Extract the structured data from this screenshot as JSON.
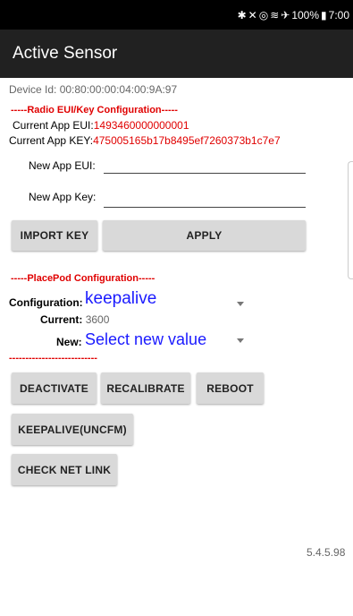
{
  "status_bar": {
    "bluetooth": "✱",
    "mute": "✕",
    "hotspot": "◎",
    "wifi": "≋",
    "airplane": "✈",
    "battery": "100%",
    "battery_icon": "▮",
    "time": "7:00"
  },
  "app_bar": {
    "title": "Active Sensor"
  },
  "device": {
    "id_label": "Device Id: 00:80:00:00:04:00:9A:97"
  },
  "radio": {
    "header": "-----Radio EUI/Key Configuration-----",
    "eui_label": "Current App EUI:",
    "eui_value": "1493460000000001",
    "key_label": "Current App KEY:",
    "key_value": "475005165b17b8495ef7260373b1c7e7",
    "new_eui_label": "New App EUI:",
    "new_eui_value": "",
    "new_key_label": "New App Key:",
    "new_key_value": ""
  },
  "buttons": {
    "import_key": "IMPORT KEY",
    "apply": "APPLY",
    "deactivate": "DEACTIVATE",
    "recalibrate": "RECALIBRATE",
    "reboot": "REBOOT",
    "keepalive": "KEEPALIVE(UNCFM)",
    "check_net_link": "CHECK NET LINK"
  },
  "placepod": {
    "header": "-----PlacePod Configuration-----",
    "config_label": "Configuration:",
    "config_value": "keepalive",
    "current_label": "Current:",
    "current_value": "3600",
    "new_label": "New:",
    "new_value": "Select new value",
    "divider": "---------------------------"
  },
  "version": "5.4.5.98",
  "colors": {
    "accent_red": "#e00000",
    "spinner_blue": "#1a1aff",
    "appbar": "#212121"
  }
}
